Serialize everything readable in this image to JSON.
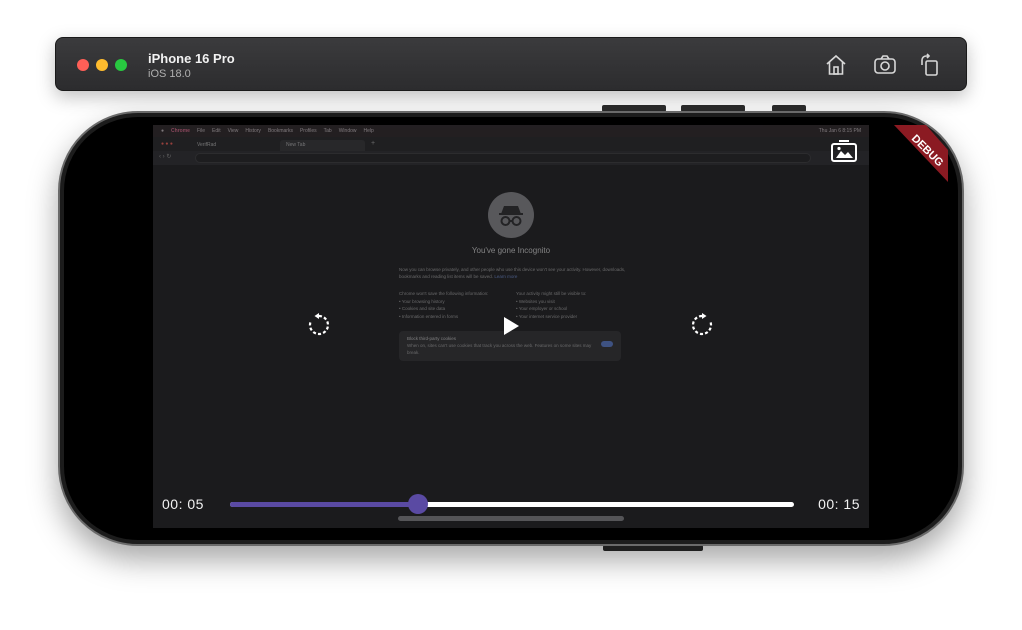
{
  "simulator": {
    "device_name": "iPhone 16 Pro",
    "os_version": "iOS 18.0",
    "buttons": [
      "home-icon",
      "screenshot-icon",
      "rotate-icon"
    ]
  },
  "video_frame": {
    "menubar": {
      "items": [
        "Chrome",
        "File",
        "Edit",
        "View",
        "History",
        "Bookmarks",
        "Profiles",
        "Tab",
        "Window",
        "Help"
      ],
      "clock": "Thu Jan 6  8:15 PM"
    },
    "tabs": [
      {
        "label": "VerifRad"
      },
      {
        "label": "New Tab"
      }
    ],
    "incognito": {
      "title": "You've gone Incognito",
      "intro": "Now you can browse privately, and other people who use this device won't see your activity. However, downloads, bookmarks and reading list items will be saved.",
      "learn_more": "Learn more",
      "not_saved_heading": "Chrome won't save the following information:",
      "not_saved": [
        "Your browsing history",
        "Cookies and site data",
        "Information entered in forms"
      ],
      "visible_heading": "Your activity might still be visible to:",
      "visible": [
        "Websites you visit",
        "Your employer or school",
        "Your internet service provider"
      ],
      "cookie_title": "Block third-party cookies",
      "cookie_text": "When on, sites can't use cookies that track you across the web. Features on some sites may break."
    }
  },
  "player": {
    "current_time": "00: 05",
    "total_time": "00: 15",
    "progress": 0.333,
    "accent_color": "#5a4aa3",
    "controls": [
      "replay-icon",
      "play-icon",
      "forward-icon",
      "picture-in-picture-icon"
    ]
  },
  "debug_banner": "DEBUG"
}
